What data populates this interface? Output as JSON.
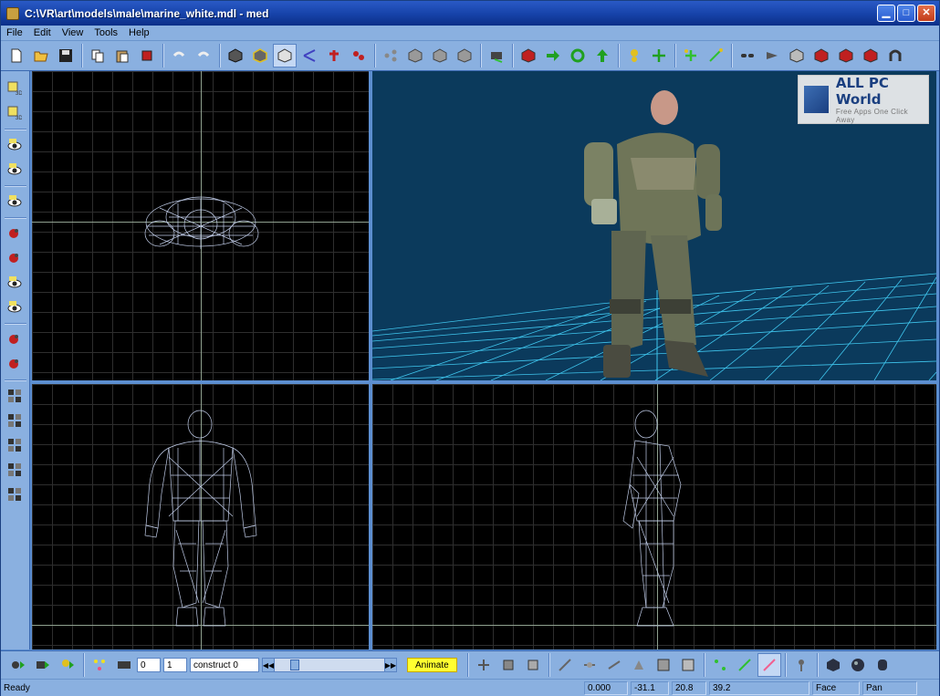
{
  "window": {
    "title": "C:\\VR\\art\\models\\male\\marine_white.mdl - med",
    "min_glyph": "▁",
    "max_glyph": "□",
    "close_glyph": "✕"
  },
  "menu": [
    "File",
    "Edit",
    "View",
    "Tools",
    "Help"
  ],
  "toolbar_icons": [
    "new-file-icon",
    "open-folder-icon",
    "save-icon",
    "copy-icon",
    "paste-icon",
    "cut-icon",
    "undo-icon",
    "redo-icon",
    "cube-select-icon",
    "cube-vertex-icon",
    "cube-face-icon",
    "bone-icon",
    "bone-select-icon",
    "translate-icon",
    "move-vertices-icon",
    "box-icon",
    "box-icon",
    "box-icon",
    "animation-icon",
    "cube-red-icon",
    "arrow-right-icon",
    "rotate-icon",
    "move-up-icon",
    "light-icon",
    "move-cross-icon",
    "add-vertex-icon",
    "add-edge-icon",
    "link-icon",
    "split-icon",
    "box-face-icon",
    "red-box-icon",
    "red-box-icon",
    "red-box-icon",
    "magnet-icon"
  ],
  "left_icons": [
    "view-3d-icon",
    "view-3d-icon",
    "eye-icon",
    "eye-icon",
    "eye-icon",
    "red-ball-icon",
    "red-ball-icon",
    "eye-icon",
    "eye-icon",
    "red-ball-icon",
    "red-ball-icon",
    "grid-icon",
    "grid-icon",
    "grid-icon",
    "grid-icon",
    "grid-icon"
  ],
  "watermark": {
    "title": "ALL PC World",
    "subtitle": "Free Apps One Click Away"
  },
  "bottom": {
    "frame_start": "0",
    "frame_end": "1",
    "sequence": "construct 0",
    "animate_label": "Animate",
    "slider_left": "◀◀",
    "slider_right": "▶▶"
  },
  "status": {
    "ready": "Ready",
    "v0": "0.000",
    "v1": "-31.1",
    "v2": "20.8",
    "v3": "39.2",
    "mode": "Face",
    "action": "Pan"
  },
  "colors": {
    "accent": "#0a246a",
    "panel": "#8ab0e0",
    "grid": "#2e2e2e",
    "viewport3d": "#0b3a5c",
    "mesh": "#c0cce8"
  }
}
